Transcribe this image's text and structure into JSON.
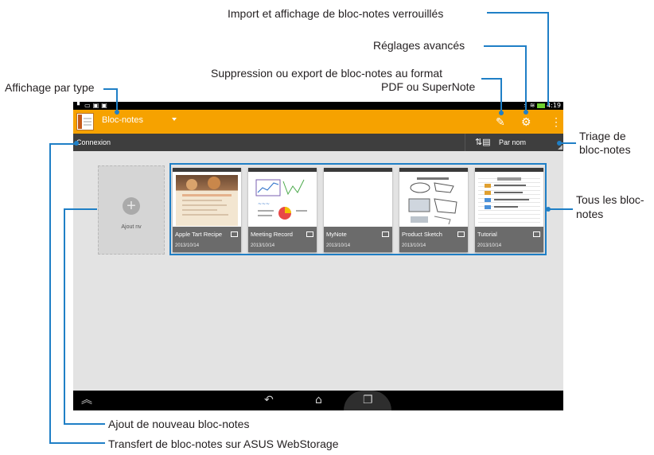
{
  "callouts": {
    "lock_import": "Import et affichage de bloc-notes verrouillés",
    "advanced_settings": "Réglages avancés",
    "delete_export_line1": "Suppression ou export de bloc-notes au format",
    "delete_export_line2": "PDF ou SuperNote",
    "display_by_type": "Affichage par type",
    "sort_line1": "Triage de",
    "sort_line2": "bloc-notes",
    "all_line1": "Tous les bloc-",
    "all_line2": "notes",
    "add_new": "Ajout de nouveau bloc-notes",
    "transfer": "Transfert de bloc-notes sur ASUS WebStorage"
  },
  "statusbar": {
    "time": "4:19"
  },
  "actionbar": {
    "type_selected": "Bloc-notes"
  },
  "subbar": {
    "login": "Connexion",
    "sort": "Par nom"
  },
  "add_tile": {
    "label": "Ajout nv",
    "icon": "plus-icon"
  },
  "notebooks": [
    {
      "name": "Apple Tart Recipe",
      "date": "2013/10/14"
    },
    {
      "name": "Meeting Record",
      "date": "2013/10/14"
    },
    {
      "name": "MyNote",
      "date": "2013/10/14"
    },
    {
      "name": "Product Sketch",
      "date": "2013/10/14"
    },
    {
      "name": "Tutorial",
      "date": "2013/10/14"
    }
  ],
  "colors": {
    "accent": "#f6a200",
    "callout_line": "#1f7fc6",
    "dark_bar": "#3e3e3e"
  }
}
